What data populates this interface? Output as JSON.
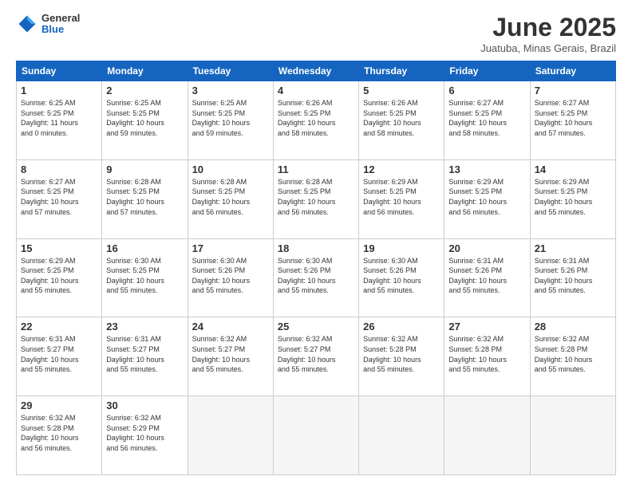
{
  "header": {
    "logo_general": "General",
    "logo_blue": "Blue",
    "month_title": "June 2025",
    "location": "Juatuba, Minas Gerais, Brazil"
  },
  "columns": [
    "Sunday",
    "Monday",
    "Tuesday",
    "Wednesday",
    "Thursday",
    "Friday",
    "Saturday"
  ],
  "weeks": [
    [
      {
        "day": "1",
        "text": "Sunrise: 6:25 AM\nSunset: 5:25 PM\nDaylight: 11 hours\nand 0 minutes."
      },
      {
        "day": "2",
        "text": "Sunrise: 6:25 AM\nSunset: 5:25 PM\nDaylight: 10 hours\nand 59 minutes."
      },
      {
        "day": "3",
        "text": "Sunrise: 6:25 AM\nSunset: 5:25 PM\nDaylight: 10 hours\nand 59 minutes."
      },
      {
        "day": "4",
        "text": "Sunrise: 6:26 AM\nSunset: 5:25 PM\nDaylight: 10 hours\nand 58 minutes."
      },
      {
        "day": "5",
        "text": "Sunrise: 6:26 AM\nSunset: 5:25 PM\nDaylight: 10 hours\nand 58 minutes."
      },
      {
        "day": "6",
        "text": "Sunrise: 6:27 AM\nSunset: 5:25 PM\nDaylight: 10 hours\nand 58 minutes."
      },
      {
        "day": "7",
        "text": "Sunrise: 6:27 AM\nSunset: 5:25 PM\nDaylight: 10 hours\nand 57 minutes."
      }
    ],
    [
      {
        "day": "8",
        "text": "Sunrise: 6:27 AM\nSunset: 5:25 PM\nDaylight: 10 hours\nand 57 minutes."
      },
      {
        "day": "9",
        "text": "Sunrise: 6:28 AM\nSunset: 5:25 PM\nDaylight: 10 hours\nand 57 minutes."
      },
      {
        "day": "10",
        "text": "Sunrise: 6:28 AM\nSunset: 5:25 PM\nDaylight: 10 hours\nand 56 minutes."
      },
      {
        "day": "11",
        "text": "Sunrise: 6:28 AM\nSunset: 5:25 PM\nDaylight: 10 hours\nand 56 minutes."
      },
      {
        "day": "12",
        "text": "Sunrise: 6:29 AM\nSunset: 5:25 PM\nDaylight: 10 hours\nand 56 minutes."
      },
      {
        "day": "13",
        "text": "Sunrise: 6:29 AM\nSunset: 5:25 PM\nDaylight: 10 hours\nand 56 minutes."
      },
      {
        "day": "14",
        "text": "Sunrise: 6:29 AM\nSunset: 5:25 PM\nDaylight: 10 hours\nand 55 minutes."
      }
    ],
    [
      {
        "day": "15",
        "text": "Sunrise: 6:29 AM\nSunset: 5:25 PM\nDaylight: 10 hours\nand 55 minutes."
      },
      {
        "day": "16",
        "text": "Sunrise: 6:30 AM\nSunset: 5:25 PM\nDaylight: 10 hours\nand 55 minutes."
      },
      {
        "day": "17",
        "text": "Sunrise: 6:30 AM\nSunset: 5:26 PM\nDaylight: 10 hours\nand 55 minutes."
      },
      {
        "day": "18",
        "text": "Sunrise: 6:30 AM\nSunset: 5:26 PM\nDaylight: 10 hours\nand 55 minutes."
      },
      {
        "day": "19",
        "text": "Sunrise: 6:30 AM\nSunset: 5:26 PM\nDaylight: 10 hours\nand 55 minutes."
      },
      {
        "day": "20",
        "text": "Sunrise: 6:31 AM\nSunset: 5:26 PM\nDaylight: 10 hours\nand 55 minutes."
      },
      {
        "day": "21",
        "text": "Sunrise: 6:31 AM\nSunset: 5:26 PM\nDaylight: 10 hours\nand 55 minutes."
      }
    ],
    [
      {
        "day": "22",
        "text": "Sunrise: 6:31 AM\nSunset: 5:27 PM\nDaylight: 10 hours\nand 55 minutes."
      },
      {
        "day": "23",
        "text": "Sunrise: 6:31 AM\nSunset: 5:27 PM\nDaylight: 10 hours\nand 55 minutes."
      },
      {
        "day": "24",
        "text": "Sunrise: 6:32 AM\nSunset: 5:27 PM\nDaylight: 10 hours\nand 55 minutes."
      },
      {
        "day": "25",
        "text": "Sunrise: 6:32 AM\nSunset: 5:27 PM\nDaylight: 10 hours\nand 55 minutes."
      },
      {
        "day": "26",
        "text": "Sunrise: 6:32 AM\nSunset: 5:28 PM\nDaylight: 10 hours\nand 55 minutes."
      },
      {
        "day": "27",
        "text": "Sunrise: 6:32 AM\nSunset: 5:28 PM\nDaylight: 10 hours\nand 55 minutes."
      },
      {
        "day": "28",
        "text": "Sunrise: 6:32 AM\nSunset: 5:28 PM\nDaylight: 10 hours\nand 55 minutes."
      }
    ],
    [
      {
        "day": "29",
        "text": "Sunrise: 6:32 AM\nSunset: 5:28 PM\nDaylight: 10 hours\nand 56 minutes."
      },
      {
        "day": "30",
        "text": "Sunrise: 6:32 AM\nSunset: 5:29 PM\nDaylight: 10 hours\nand 56 minutes."
      },
      {
        "day": "",
        "text": ""
      },
      {
        "day": "",
        "text": ""
      },
      {
        "day": "",
        "text": ""
      },
      {
        "day": "",
        "text": ""
      },
      {
        "day": "",
        "text": ""
      }
    ]
  ]
}
